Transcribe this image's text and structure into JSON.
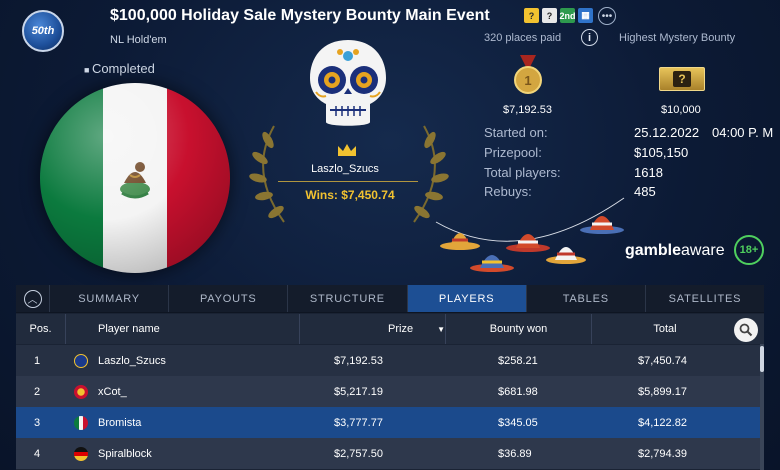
{
  "header": {
    "logo_text": "50th",
    "title": "$100,000 Holiday Sale Mystery Bounty Main Event",
    "subtitle": "NL Hold'em",
    "places_paid": "320 places paid",
    "highest_label": "Highest Mystery Bounty",
    "status": "Completed",
    "badges": [
      "?",
      "?",
      "2nd",
      "▦"
    ],
    "more_icon": "more-icon"
  },
  "winner": {
    "name": "Laszlo_Szucs",
    "wins": "Wins: $7,450.74"
  },
  "prizes": {
    "first": "$7,192.53",
    "mystery": "$10,000"
  },
  "info": {
    "started_label": "Started on:",
    "started_date": "25.12.2022",
    "started_time": "04:00 P. M",
    "prizepool_label": "Prizepool:",
    "prizepool": "$105,150",
    "players_label": "Total players:",
    "players": "1618",
    "rebuys_label": "Rebuys:",
    "rebuys": "485"
  },
  "gambleaware": {
    "gamble": "gamble",
    "aware": "aware",
    "age": "18+"
  },
  "tabs": [
    "SUMMARY",
    "PAYOUTS",
    "STRUCTURE",
    "PLAYERS",
    "TABLES",
    "SATELLITES"
  ],
  "active_tab": "PLAYERS",
  "table": {
    "columns": [
      "Pos.",
      "Player name",
      "Prize",
      "Bounty won",
      "Total"
    ],
    "rows": [
      {
        "pos": "1",
        "name": "Laszlo_Szucs",
        "prize": "$7,192.53",
        "bounty": "$258.21",
        "total": "$7,450.74",
        "flag": "eu"
      },
      {
        "pos": "2",
        "name": "xCot_",
        "prize": "$5,217.19",
        "bounty": "$681.98",
        "total": "$5,899.17",
        "flag": "kg"
      },
      {
        "pos": "3",
        "name": "Bromista",
        "prize": "$3,777.77",
        "bounty": "$345.05",
        "total": "$4,122.82",
        "flag": "mx"
      },
      {
        "pos": "4",
        "name": "Spiralblock",
        "prize": "$2,757.50",
        "bounty": "$36.89",
        "total": "$2,794.39",
        "flag": "de"
      }
    ]
  },
  "colors": {
    "background": "#0c1a35",
    "accent": "#1d4f94",
    "gold": "#f2c230",
    "gamble_green": "#4fcf5e"
  }
}
